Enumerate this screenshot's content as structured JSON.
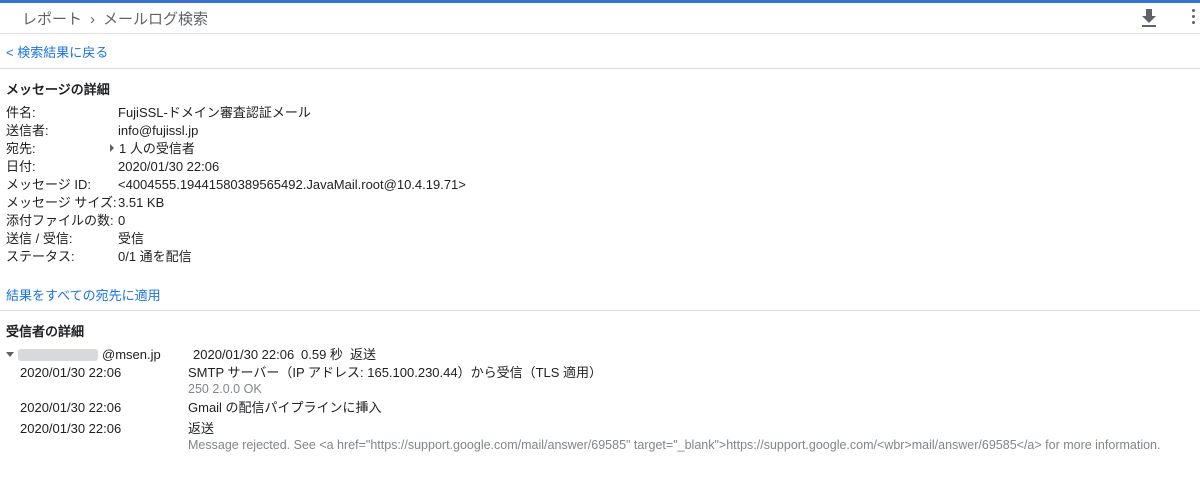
{
  "header": {
    "breadcrumb_root": "レポート",
    "breadcrumb_sep": "›",
    "breadcrumb_current": "メールログ検索"
  },
  "back_link": "< 検索結果に戻る",
  "message_details": {
    "title": "メッセージの詳細",
    "fields": [
      {
        "label": "件名:",
        "value": "FujiSSL-ドメイン審査認証メール"
      },
      {
        "label": "送信者:",
        "value": "info@fujissl.jp"
      },
      {
        "label": "宛先:",
        "value": "1 人の受信者"
      },
      {
        "label": "日付:",
        "value": "2020/01/30 22:06"
      },
      {
        "label": "メッセージ ID:",
        "value": "<4004555.19441580389565492.JavaMail.root@10.4.19.71>"
      },
      {
        "label": "メッセージ サイズ:",
        "value": "3.51 KB"
      },
      {
        "label": "添付ファイルの数:",
        "value": "0"
      },
      {
        "label": "送信 / 受信:",
        "value": "受信"
      },
      {
        "label": "ステータス:",
        "value": "0/1 通を配信"
      }
    ]
  },
  "apply_link": "結果をすべての宛先に適用",
  "recipient_details": {
    "title": "受信者の詳細",
    "recipient": {
      "address_suffix": "@msen.jp",
      "date": "2020/01/30 22:06",
      "duration": "0.59 秒",
      "result": "返送"
    },
    "events": [
      {
        "date": "2020/01/30 22:06",
        "message": "SMTP サーバー（IP アドレス: 165.100.230.44）から受信（TLS 適用）",
        "sub": "250 2.0.0 OK"
      },
      {
        "date": "2020/01/30 22:06",
        "message": "Gmail の配信パイプラインに挿入",
        "sub": ""
      },
      {
        "date": "2020/01/30 22:06",
        "message": "返送",
        "sub": "Message rejected. See <a href=\"https://support.google.com/mail/answer/69585\" target=\"_blank\">https://support.google.com/<wbr>mail/answer/69585</a> for more information."
      }
    ]
  },
  "colors": {
    "accent": "#1a73e8",
    "top_bar": "#3a71d1",
    "muted": "#80868b"
  },
  "icons": {
    "download": "download-icon",
    "more": "more-vert-icon"
  }
}
